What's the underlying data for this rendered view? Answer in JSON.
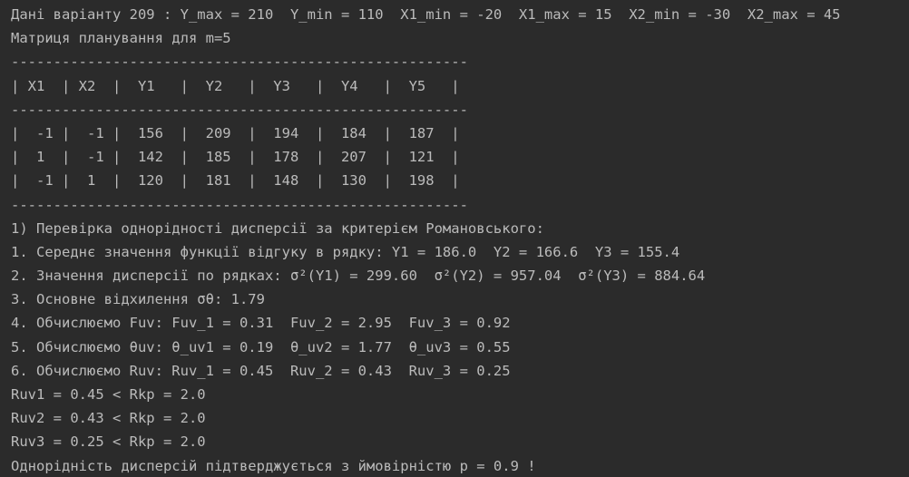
{
  "console": {
    "lines": [
      "Дані варіанту 209 : Y_max = 210  Y_min = 110  X1_min = -20  X1_max = 15  X2_min = -30  X2_max = 45",
      "Матриця планування для m=5",
      "------------------------------------------------------",
      "| X1  | X2  |  Y1   |  Y2   |  Y3   |  Y4   |  Y5   |",
      "------------------------------------------------------",
      "|  -1 |  -1 |  156  |  209  |  194  |  184  |  187  |",
      "|  1  |  -1 |  142  |  185  |  178  |  207  |  121  |",
      "|  -1 |  1  |  120  |  181  |  148  |  130  |  198  |",
      "------------------------------------------------------",
      "1) Перевірка однорідності дисперсії за критерієм Романовського:",
      "1. Середнє значення функції відгуку в рядку: Y1 = 186.0  Y2 = 166.6  Y3 = 155.4",
      "2. Значення дисперсії по рядках: σ²(Y1) = 299.60  σ²(Y2) = 957.04  σ²(Y3) = 884.64",
      "3. Основне відхилення σθ: 1.79",
      "4. Обчислюємо Fuv: Fuv_1 = 0.31  Fuv_2 = 2.95  Fuv_3 = 0.92",
      "5. Обчислюємо θuv: θ_uv1 = 0.19  θ_uv2 = 1.77  θ_uv3 = 0.55",
      "6. Обчислюємо Ruv: Ruv_1 = 0.45  Ruv_2 = 0.43  Ruv_3 = 0.25",
      "Ruv1 = 0.45 < Rkp = 2.0",
      "Ruv2 = 0.43 < Rkp = 2.0",
      "Ruv3 = 0.25 < Rkp = 2.0",
      "Однорідність дисперсій підтверджується з ймовірністю p = 0.9 !"
    ]
  }
}
